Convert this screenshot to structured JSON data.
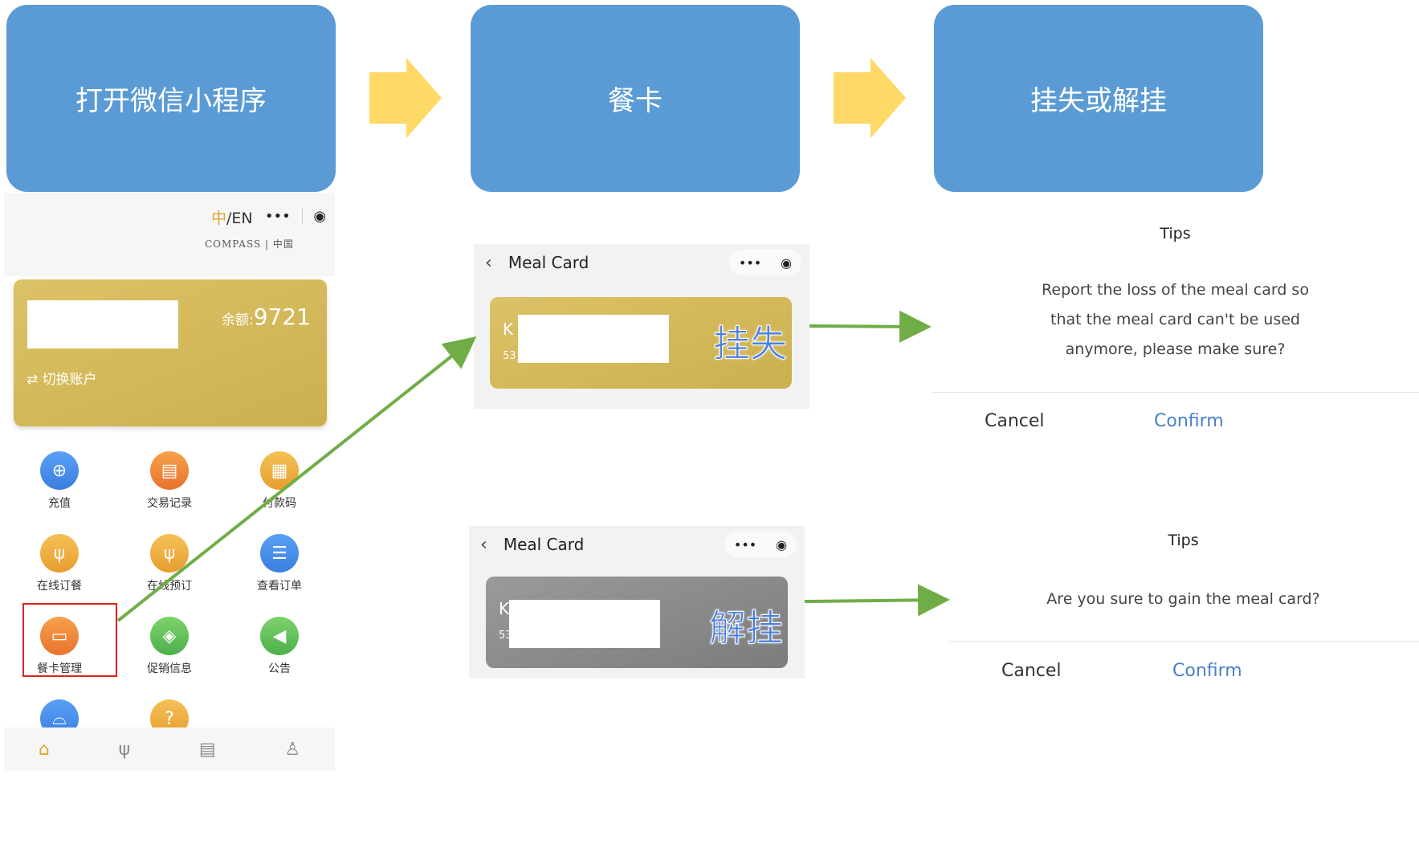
{
  "steps": [
    {
      "label": "打开微信小程序"
    },
    {
      "label": "餐卡"
    },
    {
      "label": "挂失或解挂"
    }
  ],
  "phone": {
    "lang_zh": "中",
    "lang_sep": "/EN",
    "menu_dots": "•••",
    "record_icon": "◉",
    "logo_text": "COMPASS | 中国",
    "balance_label": "余额:",
    "balance_value": "9721",
    "switch_label": "⇄ 切换账户",
    "grid": [
      {
        "label": "充值",
        "icon": "recharge-icon"
      },
      {
        "label": "交易记录",
        "icon": "record-icon"
      },
      {
        "label": "付款码",
        "icon": "qrcode-icon"
      },
      {
        "label": "在线订餐",
        "icon": "fork-icon"
      },
      {
        "label": "在线预订",
        "icon": "fork-icon"
      },
      {
        "label": "查看订单",
        "icon": "order-icon"
      },
      {
        "label": "餐卡管理",
        "icon": "card-icon"
      },
      {
        "label": "促销信息",
        "icon": "tag-icon"
      },
      {
        "label": "公告",
        "icon": "speaker-icon"
      }
    ]
  },
  "meal_card_panels": [
    {
      "title": "Meal Card",
      "back": "‹",
      "stamp": "挂失",
      "card_prefix": "K",
      "card_num_prefix": "53"
    },
    {
      "title": "Meal Card",
      "back": "‹",
      "stamp": "解挂",
      "card_prefix": "K",
      "card_num_prefix": "53"
    }
  ],
  "dialogs": [
    {
      "title": "Tips",
      "message_lines": [
        "Report the loss of the meal card so",
        "that the meal card can't be used",
        "anymore, please make sure?"
      ],
      "cancel": "Cancel",
      "confirm": "Confirm"
    },
    {
      "title": "Tips",
      "message_lines": [
        "Are you sure to gain the meal card?"
      ],
      "cancel": "Cancel",
      "confirm": "Confirm"
    }
  ],
  "colors": {
    "step_box": "#5b9bd5",
    "chevron": "#ffd966",
    "connector": "#70ad47",
    "highlight": "#e02020"
  }
}
